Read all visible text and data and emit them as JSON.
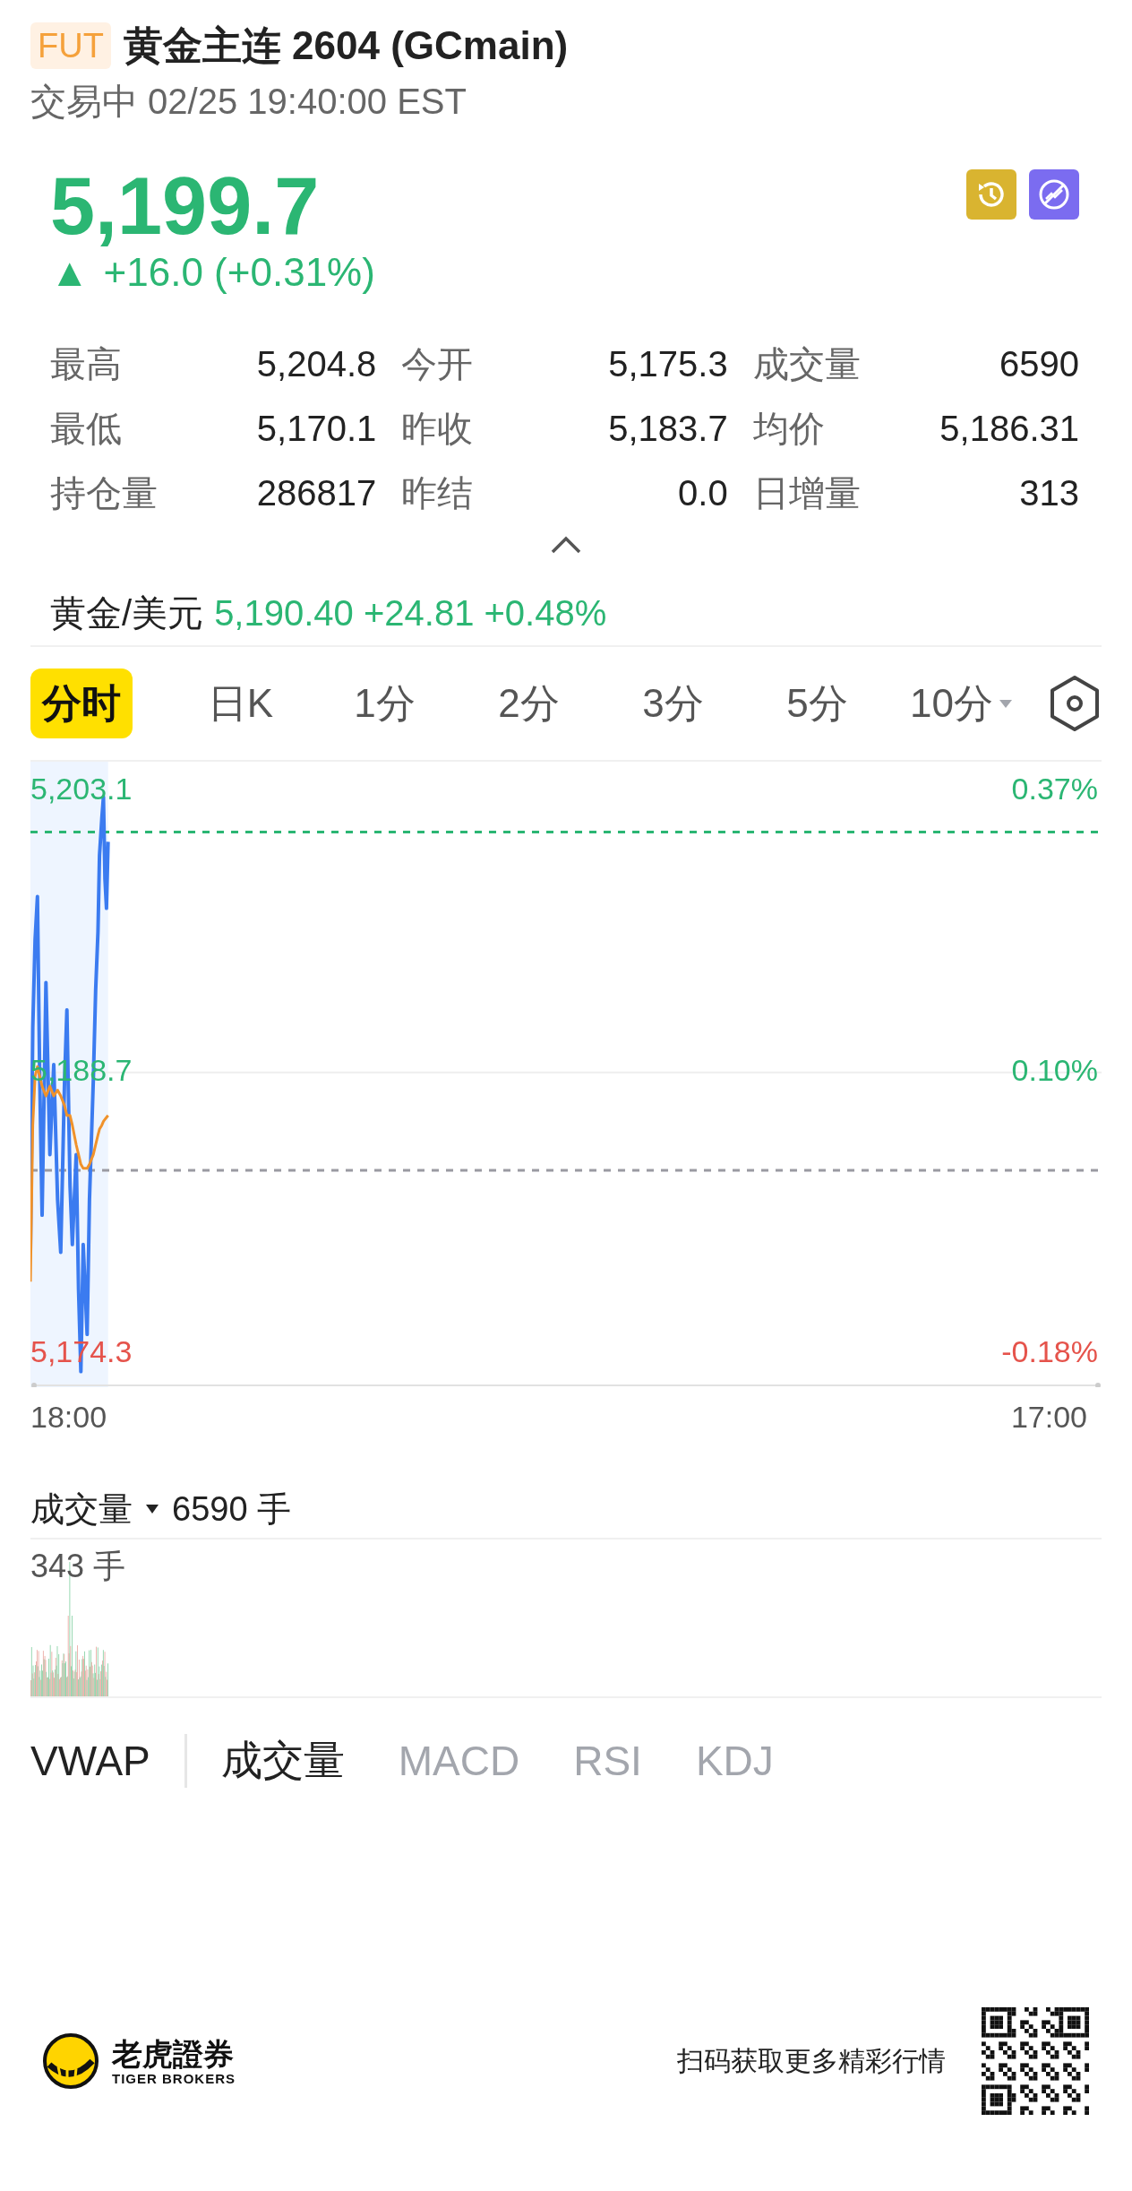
{
  "header": {
    "badge": "FUT",
    "title": "黄金主连 2604 (GCmain)",
    "status": "交易中 02/25 19:40:00 EST"
  },
  "quote": {
    "price": "5,199.7",
    "rising": true,
    "arrow": "▲",
    "change": "+16.0 (+0.31%)"
  },
  "stats": [
    {
      "label": "最高",
      "value": "5,204.8"
    },
    {
      "label": "今开",
      "value": "5,175.3"
    },
    {
      "label": "成交量",
      "value": "6590"
    },
    {
      "label": "最低",
      "value": "5,170.1"
    },
    {
      "label": "昨收",
      "value": "5,183.7"
    },
    {
      "label": "均价",
      "value": "5,186.31"
    },
    {
      "label": "持仓量",
      "value": "286817"
    },
    {
      "label": "昨结",
      "value": "0.0"
    },
    {
      "label": "日增量",
      "value": "313"
    }
  ],
  "related": {
    "name": "黄金/美元",
    "quote": "5,190.40 +24.81 +0.48%"
  },
  "period_tabs": [
    {
      "label": "分时",
      "selected": true,
      "dropdown": false
    },
    {
      "label": "日K",
      "selected": false,
      "dropdown": false
    },
    {
      "label": "1分",
      "selected": false,
      "dropdown": false
    },
    {
      "label": "2分",
      "selected": false,
      "dropdown": false
    },
    {
      "label": "3分",
      "selected": false,
      "dropdown": false
    },
    {
      "label": "5分",
      "selected": false,
      "dropdown": false
    },
    {
      "label": "10分",
      "selected": false,
      "dropdown": true
    }
  ],
  "chart": {
    "price_labels": [
      {
        "text": "5,203.1",
        "color": "#2bb673"
      },
      {
        "text": "5,188.7",
        "color": "#2bb673"
      },
      {
        "text": "5,174.3",
        "color": "#e5534b"
      }
    ],
    "percent_labels": [
      {
        "text": "0.37%",
        "color": "#2bb673"
      },
      {
        "text": "0.10%",
        "color": "#2bb673"
      },
      {
        "text": "-0.18%",
        "color": "#e5534b"
      }
    ],
    "time_labels": [
      "18:00",
      "17:00"
    ]
  },
  "volume": {
    "label": "成交量",
    "total": "6590 手",
    "max_label": "343 手"
  },
  "main_indicators": [
    {
      "label": "VWAP",
      "selected": true
    }
  ],
  "sub_indicators": [
    {
      "label": "成交量",
      "selected": true
    },
    {
      "label": "MACD",
      "selected": false
    },
    {
      "label": "RSI",
      "selected": false
    },
    {
      "label": "KDJ",
      "selected": false
    }
  ],
  "footer": {
    "brand_cn": "老虎證券",
    "brand_en": "TIGER BROKERS",
    "qr_caption": "扫码获取更多精彩行情"
  }
}
